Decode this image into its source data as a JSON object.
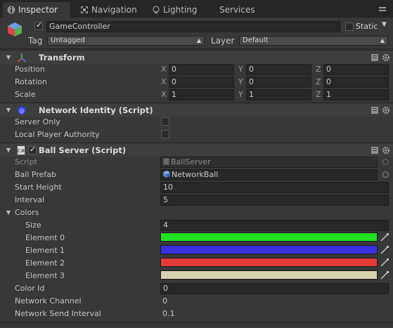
{
  "tabs": [
    {
      "label": "Inspector",
      "icon": "info-icon",
      "active": true
    },
    {
      "label": "Navigation",
      "icon": "navigation-icon",
      "active": false
    },
    {
      "label": "Lighting",
      "icon": "lightbulb-icon",
      "active": false
    },
    {
      "label": "Services",
      "icon": "",
      "active": false
    }
  ],
  "gameobject": {
    "name": "GameController",
    "static_label": "Static",
    "tag_label": "Tag",
    "tag_value": "Untagged",
    "layer_label": "Layer",
    "layer_value": "Default"
  },
  "transform": {
    "title": "Transform",
    "position_label": "Position",
    "rotation_label": "Rotation",
    "scale_label": "Scale",
    "axis_x": "X",
    "axis_y": "Y",
    "axis_z": "Z",
    "position": {
      "x": "0",
      "y": "0",
      "z": "0"
    },
    "rotation": {
      "x": "0",
      "y": "0",
      "z": "0"
    },
    "scale": {
      "x": "1",
      "y": "1",
      "z": "1"
    }
  },
  "network_identity": {
    "title": "Network Identity (Script)",
    "server_only_label": "Server Only",
    "server_only": false,
    "local_player_authority_label": "Local Player Authority",
    "local_player_authority": false
  },
  "ball_server": {
    "title": "Ball Server (Script)",
    "script_label": "Script",
    "script_value": "BallServer",
    "ball_prefab_label": "Ball Prefab",
    "ball_prefab_value": "NetworkBall",
    "start_height_label": "Start Height",
    "start_height_value": "10",
    "interval_label": "Interval",
    "interval_value": "5",
    "colors_label": "Colors",
    "size_label": "Size",
    "size_value": "4",
    "elements": [
      {
        "label": "Element 0",
        "color": "#22e022"
      },
      {
        "label": "Element 1",
        "color": "#3a2fe0"
      },
      {
        "label": "Element 2",
        "color": "#e43a3a"
      },
      {
        "label": "Element 3",
        "color": "#d6d2b2"
      }
    ],
    "color_id_label": "Color Id",
    "color_id_value": "0",
    "network_channel_label": "Network Channel",
    "network_channel_value": "0",
    "network_send_interval_label": "Network Send Interval",
    "network_send_interval_value": "0.1"
  }
}
